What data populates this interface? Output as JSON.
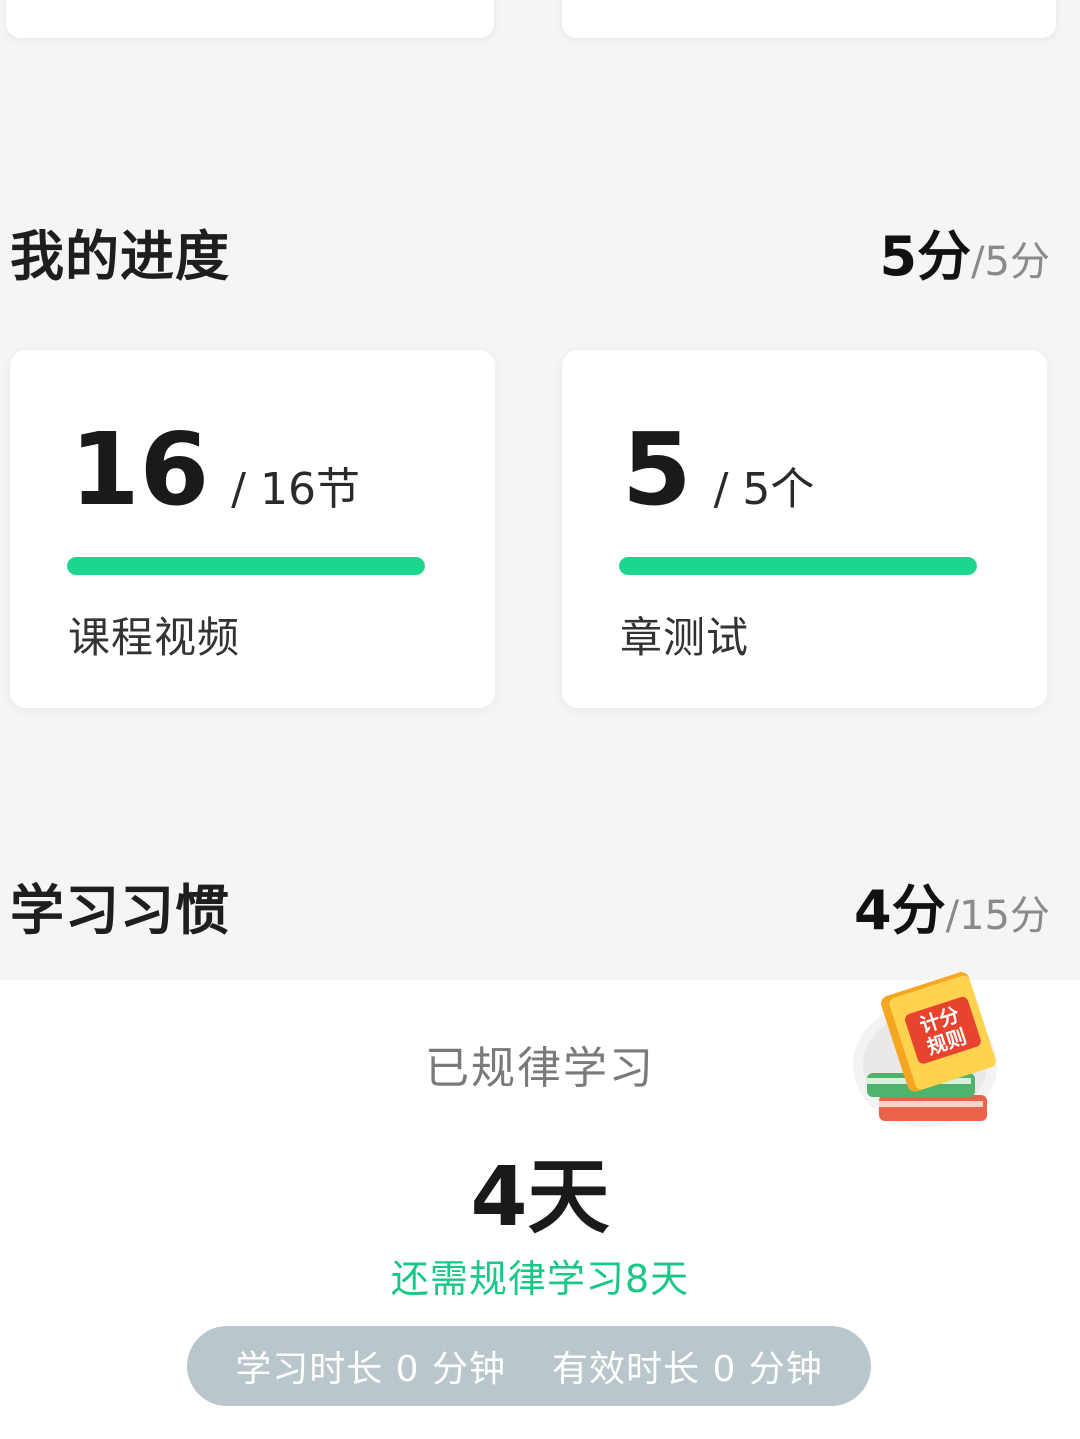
{
  "progress": {
    "title": "我的进度",
    "score_value": "5分",
    "score_total": "/5分",
    "cards": [
      {
        "current": "16",
        "total": "/ 16节",
        "label": "课程视频",
        "fill": 1.0
      },
      {
        "current": "5",
        "total": "/ 5个",
        "label": "章测试",
        "fill": 1.0
      }
    ]
  },
  "habit": {
    "title": "学习习惯",
    "score_value": "4分",
    "score_total": "/15分",
    "caption": "已规律学习",
    "days": "4天",
    "remaining": "还需规律学习8天",
    "study_duration": "学习时长 0 分钟",
    "effective_duration": "有效时长 0 分钟",
    "rules_badge": [
      "计分",
      "规则"
    ]
  },
  "colors": {
    "accent_green": "#1dd68e",
    "pill_gray": "#b9c6cc",
    "background": "#f5f5f5"
  }
}
